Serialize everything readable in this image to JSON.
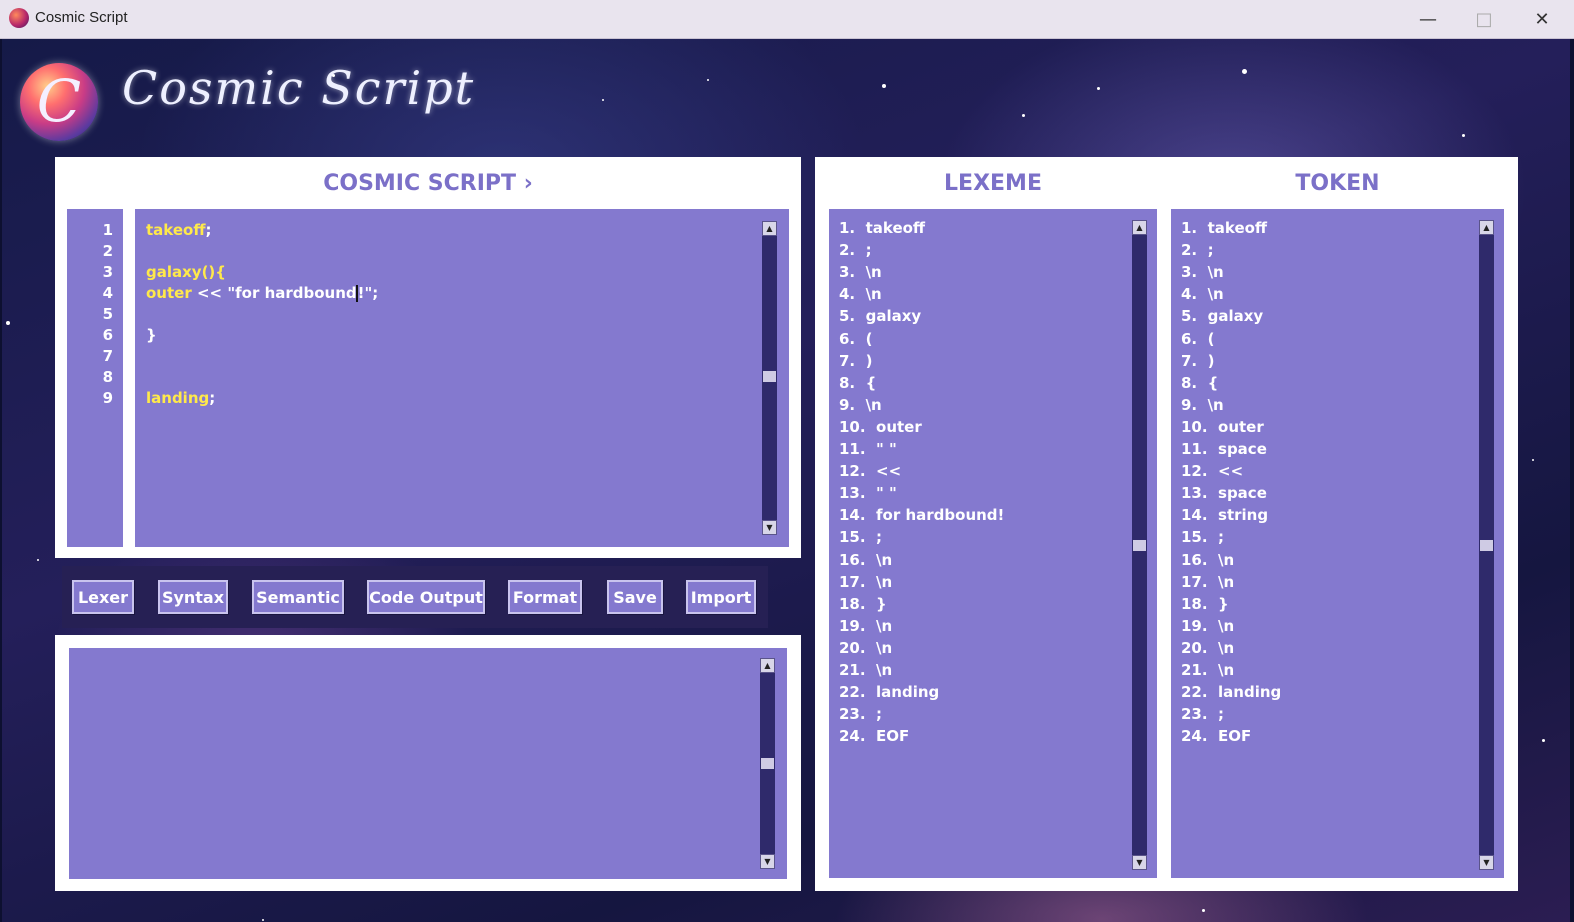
{
  "window": {
    "title": "Cosmic Script",
    "minimize_icon": "minimize-icon",
    "maximize_icon": "maximize-icon",
    "close_icon": "close-icon"
  },
  "logo": {
    "badge_letter": "C",
    "text": "Cosmic Script"
  },
  "editor": {
    "title": "COSMIC SCRIPT ›",
    "line_numbers": [
      "1",
      "2",
      "3",
      "4",
      "5",
      "6",
      "7",
      "8",
      "9"
    ],
    "lines": [
      {
        "kw": "takeoff",
        "rest": ";"
      },
      {
        "kw": "",
        "rest": ""
      },
      {
        "kw": "galaxy(){",
        "rest": ""
      },
      {
        "kw": "outer",
        "rest": " << \"for hardbound!\";"
      },
      {
        "kw": "",
        "rest": ""
      },
      {
        "kw": "",
        "rest": "}"
      },
      {
        "kw": "",
        "rest": ""
      },
      {
        "kw": "",
        "rest": ""
      },
      {
        "kw": "landing",
        "rest": ";"
      }
    ]
  },
  "toolbar": {
    "lexer": "Lexer",
    "syntax": "Syntax",
    "semantic": "Semantic",
    "code_output": "Code Output",
    "format": "Format",
    "save": "Save",
    "import": "Import"
  },
  "output": {
    "text": ""
  },
  "lexeme": {
    "title": "LEXEME",
    "rows": [
      "1.  takeoff",
      "2.  ;",
      "3.  \\n",
      "4.  \\n",
      "5.  galaxy",
      "6.  (",
      "7.  )",
      "8.  {",
      "9.  \\n",
      "10.  outer",
      "11.  \" \"",
      "12.  <<",
      "13.  \" \"",
      "14.  for hardbound!",
      "15.  ;",
      "16.  \\n",
      "17.  \\n",
      "18.  }",
      "19.  \\n",
      "20.  \\n",
      "21.  \\n",
      "22.  landing",
      "23.  ;",
      "24.  EOF"
    ]
  },
  "token": {
    "title": "TOKEN",
    "rows": [
      "1.  takeoff",
      "2.  ;",
      "3.  \\n",
      "4.  \\n",
      "5.  galaxy",
      "6.  (",
      "7.  )",
      "8.  {",
      "9.  \\n",
      "10.  outer",
      "11.  space",
      "12.  <<",
      "13.  space",
      "14.  string",
      "15.  ;",
      "16.  \\n",
      "17.  \\n",
      "18.  }",
      "19.  \\n",
      "20.  \\n",
      "21.  \\n",
      "22.  landing",
      "23.  ;",
      "24.  EOF"
    ]
  },
  "colors": {
    "panel_purple": "#8479cf",
    "heading_purple": "#7b70c8",
    "keyword_yellow": "#ffe94a",
    "button_bar": "#262054"
  }
}
